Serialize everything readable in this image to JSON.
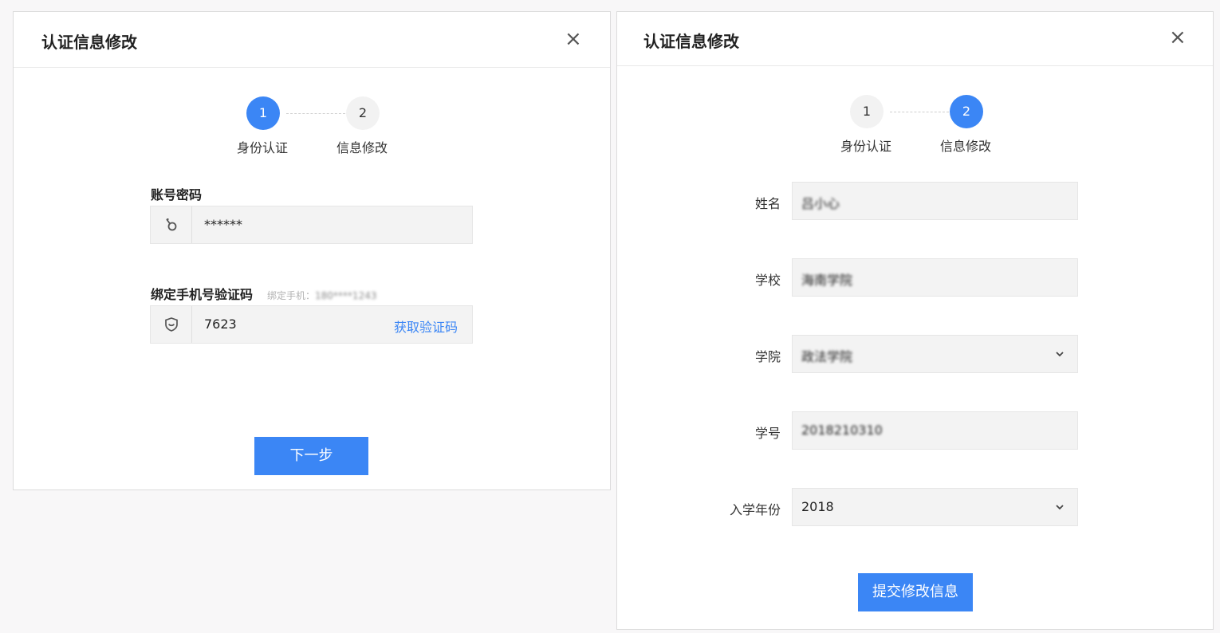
{
  "left_dialog": {
    "title": "认证信息修改",
    "close_icon": "×",
    "steps": [
      {
        "number": "1",
        "label": "身份认证",
        "active": true
      },
      {
        "number": "2",
        "label": "信息修改",
        "active": false
      }
    ],
    "password_section": {
      "label": "账号密码",
      "icon": "key-icon",
      "value": "******"
    },
    "phone_section": {
      "label": "绑定手机号验证码",
      "hint_prefix": "绑定手机：",
      "hint_phone": "180****1243",
      "icon": "shield-icon",
      "value": "7623",
      "get_code_link": "获取验证码"
    },
    "next_button": "下一步"
  },
  "right_dialog": {
    "title": "认证信息修改",
    "close_icon": "×",
    "steps": [
      {
        "number": "1",
        "label": "身份认证",
        "active": false
      },
      {
        "number": "2",
        "label": "信息修改",
        "active": true
      }
    ],
    "fields": [
      {
        "label": "姓名",
        "value": "吕小心",
        "blurred": true,
        "dropdown": false
      },
      {
        "label": "学校",
        "value": "海南学院",
        "blurred": true,
        "dropdown": false
      },
      {
        "label": "学院",
        "value": "政法学院",
        "blurred": true,
        "dropdown": true
      },
      {
        "label": "学号",
        "value": "2018210310",
        "blurred": true,
        "dropdown": false
      },
      {
        "label": "入学年份",
        "value": "2018",
        "blurred": false,
        "dropdown": true
      }
    ],
    "submit_button": "提交修改信息"
  },
  "colors": {
    "accent": "#3b86f5",
    "input_bg": "#f3f3f3",
    "page_bg": "#f8f7f8"
  }
}
